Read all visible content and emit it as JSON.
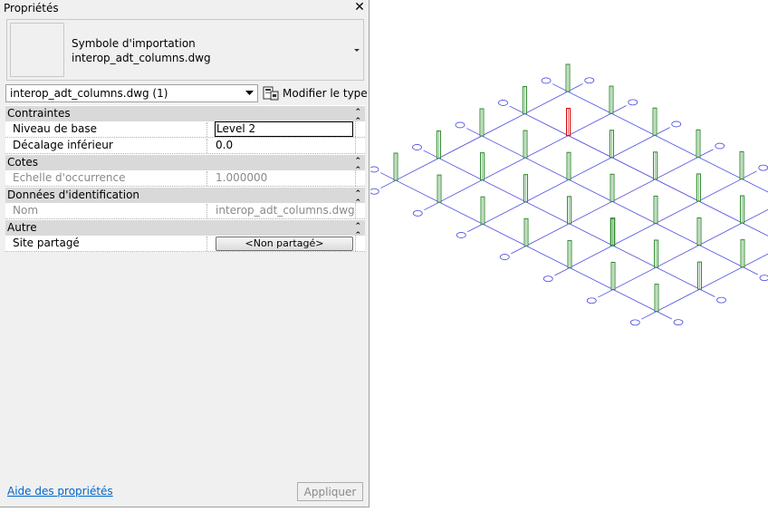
{
  "panel": {
    "title": "Propriétés",
    "type_name_line1": "Symbole d'importation",
    "type_name_line2": "interop_adt_columns.dwg",
    "selector_value": "interop_adt_columns.dwg (1)",
    "edit_type_label": "Modifier le type",
    "help_link": "Aide des propriétés",
    "apply_label": "Appliquer"
  },
  "categories": [
    {
      "label": "Contraintes",
      "rows": [
        {
          "name": "Niveau de base",
          "value": "Level 2"
        },
        {
          "name": "Décalage inférieur",
          "value": "0.0"
        }
      ]
    },
    {
      "label": "Cotes",
      "rows": [
        {
          "name": "Echelle d'occurrence",
          "value": "1.000000"
        }
      ]
    },
    {
      "label": "Données d'identification",
      "rows": [
        {
          "name": "Nom",
          "value": "interop_adt_columns.dwg"
        }
      ]
    },
    {
      "label": "Autre",
      "rows": [
        {
          "name": "Site partagé",
          "value": "<Non partagé>"
        }
      ]
    }
  ],
  "icons": {
    "close": "close-icon",
    "collapse": "collapse-chevron-icon",
    "dropdown": "chevron-down-icon",
    "edit_type": "edit-type-icon"
  },
  "colors": {
    "column_normal": "#2e8b2e",
    "column_selected": "#d40000",
    "grid_lines": "#4a4ae0"
  }
}
